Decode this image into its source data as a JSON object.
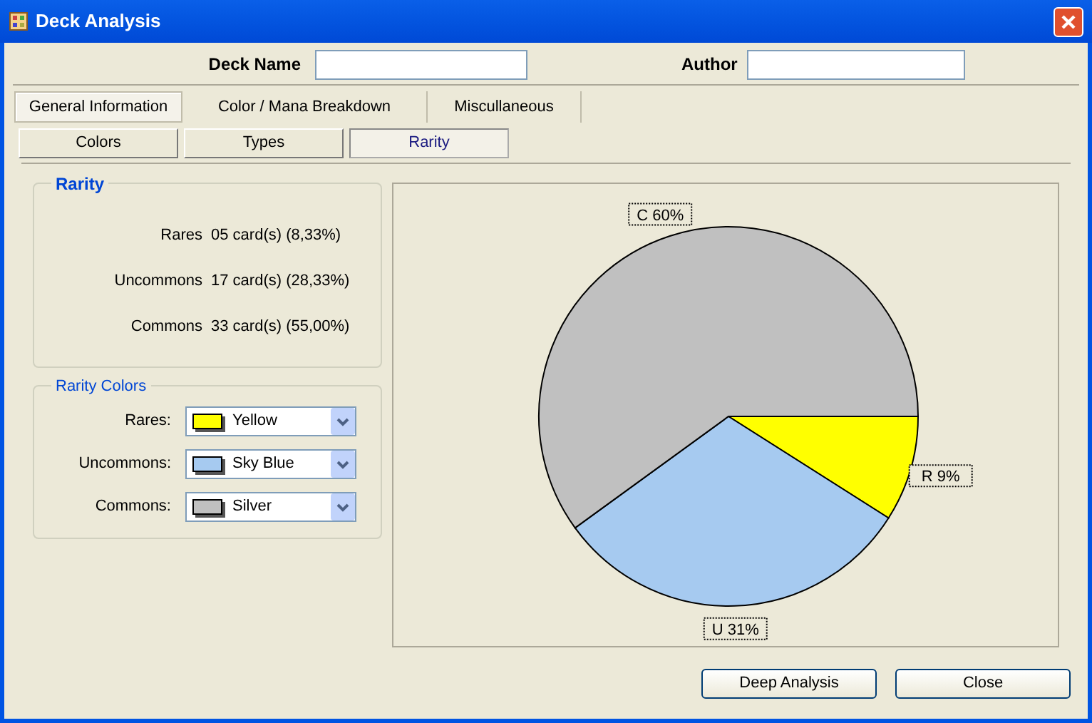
{
  "window": {
    "title": "Deck Analysis"
  },
  "header": {
    "deck_name_label": "Deck Name",
    "author_label": "Author"
  },
  "tabs": [
    {
      "label": "General Information",
      "selected": true
    },
    {
      "label": "Color / Mana Breakdown",
      "selected": false
    },
    {
      "label": "Miscullaneous",
      "selected": false
    }
  ],
  "subtabs": [
    {
      "label": "Colors",
      "selected": false
    },
    {
      "label": "Types",
      "selected": false
    },
    {
      "label": "Rarity",
      "selected": true
    }
  ],
  "rarity": {
    "title": "Rarity",
    "rows": [
      {
        "label": "Rares",
        "value": "05 card(s) (8,33%)"
      },
      {
        "label": "Uncommons",
        "value": "17 card(s) (28,33%)"
      },
      {
        "label": "Commons",
        "value": "33 card(s) (55,00%)"
      }
    ]
  },
  "rarity_colors": {
    "title": "Rarity Colors",
    "rows": [
      {
        "label": "Rares:",
        "value": "Yellow",
        "color": "#ffff00"
      },
      {
        "label": "Uncommons:",
        "value": "Sky Blue",
        "color": "#a6caf0"
      },
      {
        "label": "Commons:",
        "value": "Silver",
        "color": "#c0c0c0"
      }
    ]
  },
  "chart_data": {
    "type": "pie",
    "values": [
      9,
      31,
      60
    ],
    "value_labels": [
      "R 9%",
      "U 31%",
      "C 60%"
    ]
  },
  "buttons": [
    "Deep Analysis",
    "Close"
  ]
}
